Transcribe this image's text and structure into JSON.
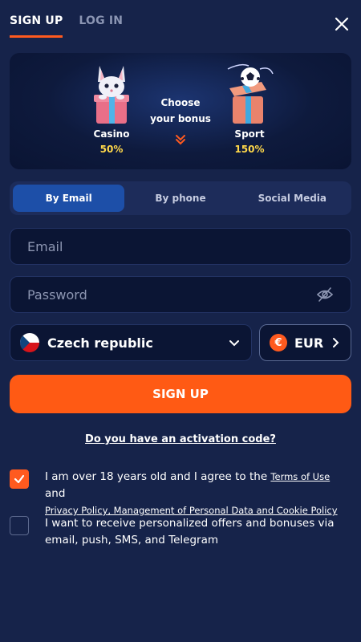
{
  "header": {
    "tabs": [
      {
        "label": "SIGN UP",
        "active": true
      },
      {
        "label": "LOG IN",
        "active": false
      }
    ],
    "close_icon": "close-icon"
  },
  "bonus": {
    "choose_line1": "Choose",
    "choose_line2": "your bonus",
    "casino": {
      "label": "Casino",
      "percent": "50%"
    },
    "sport": {
      "label": "Sport",
      "percent": "150%"
    }
  },
  "methods": [
    {
      "label": "By Email",
      "active": true
    },
    {
      "label": "By phone",
      "active": false
    },
    {
      "label": "Social Media",
      "active": false
    }
  ],
  "form": {
    "email_placeholder": "Email",
    "password_placeholder": "Password",
    "country": "Czech republic",
    "currency": "EUR",
    "currency_symbol": "€",
    "submit_label": "SIGN UP",
    "activation_link": "Do you have an activation code?"
  },
  "consents": {
    "terms": {
      "checked": true,
      "text_before": "I am over 18 years old and I agree to the ",
      "terms_link": "Terms of Use",
      "text_and": " and ",
      "privacy_link": "Privacy Policy, Management of Personal Data and Cookie Policy"
    },
    "offers": {
      "checked": false,
      "text": "I want to receive personalized offers and bonuses via email, push, SMS, and Telegram"
    }
  },
  "colors": {
    "background": "#16234a",
    "accent": "#ff5a14",
    "active_method": "#1d4fa8",
    "bonus_percent": "#ffd84a"
  }
}
